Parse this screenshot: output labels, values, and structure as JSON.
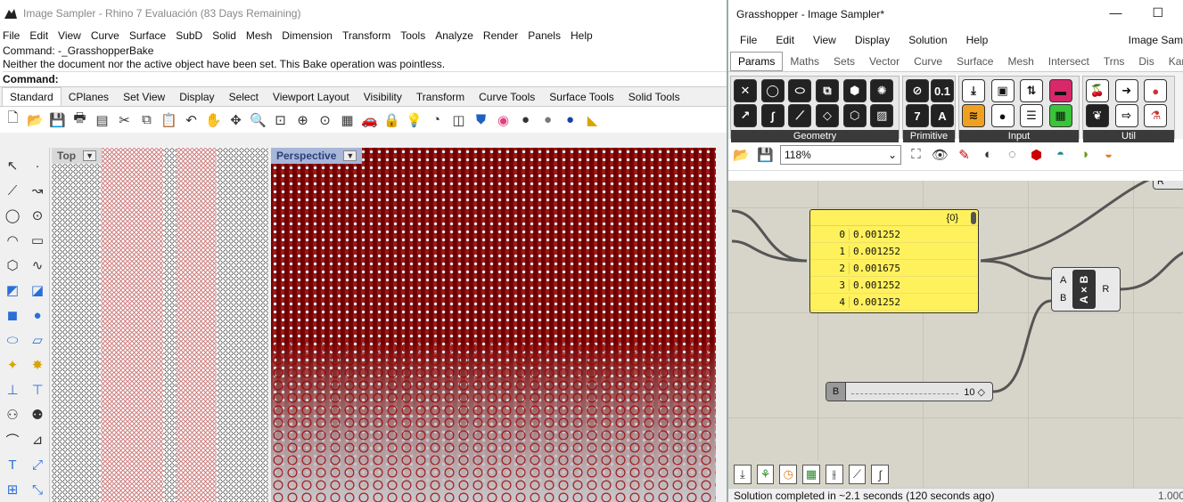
{
  "rhino": {
    "title": "Image Sampler - Rhino 7 Evaluación (83 Days Remaining)",
    "menu": [
      "File",
      "Edit",
      "View",
      "Curve",
      "Surface",
      "SubD",
      "Solid",
      "Mesh",
      "Dimension",
      "Transform",
      "Tools",
      "Analyze",
      "Render",
      "Panels",
      "Help"
    ],
    "command_history": [
      "Command: -_GrasshopperBake",
      "Neither the document nor the active object have been set. This Bake operation was pointless."
    ],
    "command_prompt": "Command:",
    "toolbar_tabs": [
      "Standard",
      "CPlanes",
      "Set View",
      "Display",
      "Select",
      "Viewport Layout",
      "Visibility",
      "Transform",
      "Curve Tools",
      "Surface Tools",
      "Solid Tools"
    ],
    "active_toolbar_tab": "Standard",
    "viewports": {
      "top": {
        "label": "Top"
      },
      "perspective": {
        "label": "Perspective"
      }
    }
  },
  "grasshopper": {
    "title": "Grasshopper - Image Sampler*",
    "window_buttons": [
      "minimize",
      "maximize"
    ],
    "menu": [
      "File",
      "Edit",
      "View",
      "Display",
      "Solution",
      "Help"
    ],
    "menu_right": "Image Sam",
    "tabs": [
      "Params",
      "Maths",
      "Sets",
      "Vector",
      "Curve",
      "Surface",
      "Mesh",
      "Intersect",
      "Trns",
      "Dis",
      "Kangar"
    ],
    "active_tab": "Params",
    "ribbon_groups": [
      {
        "label": "Geometry"
      },
      {
        "label": "Primitive"
      },
      {
        "label": "Input"
      },
      {
        "label": "Util"
      }
    ],
    "zoom": "118%",
    "panel": {
      "path": "{0}",
      "rows": [
        {
          "index": "0",
          "value": "0.001252"
        },
        {
          "index": "1",
          "value": "0.001252"
        },
        {
          "index": "2",
          "value": "0.001675"
        },
        {
          "index": "3",
          "value": "0.001252"
        },
        {
          "index": "4",
          "value": "0.001252"
        }
      ]
    },
    "multiplication": {
      "input_a": "A",
      "input_b": "B",
      "label": "A×B",
      "output": "R"
    },
    "slider": {
      "name": "B",
      "value": "10 ◇"
    },
    "partial_node_label": "R",
    "status": "Solution completed in ~2.1 seconds (120 seconds ago)",
    "status_right": "1.000"
  }
}
